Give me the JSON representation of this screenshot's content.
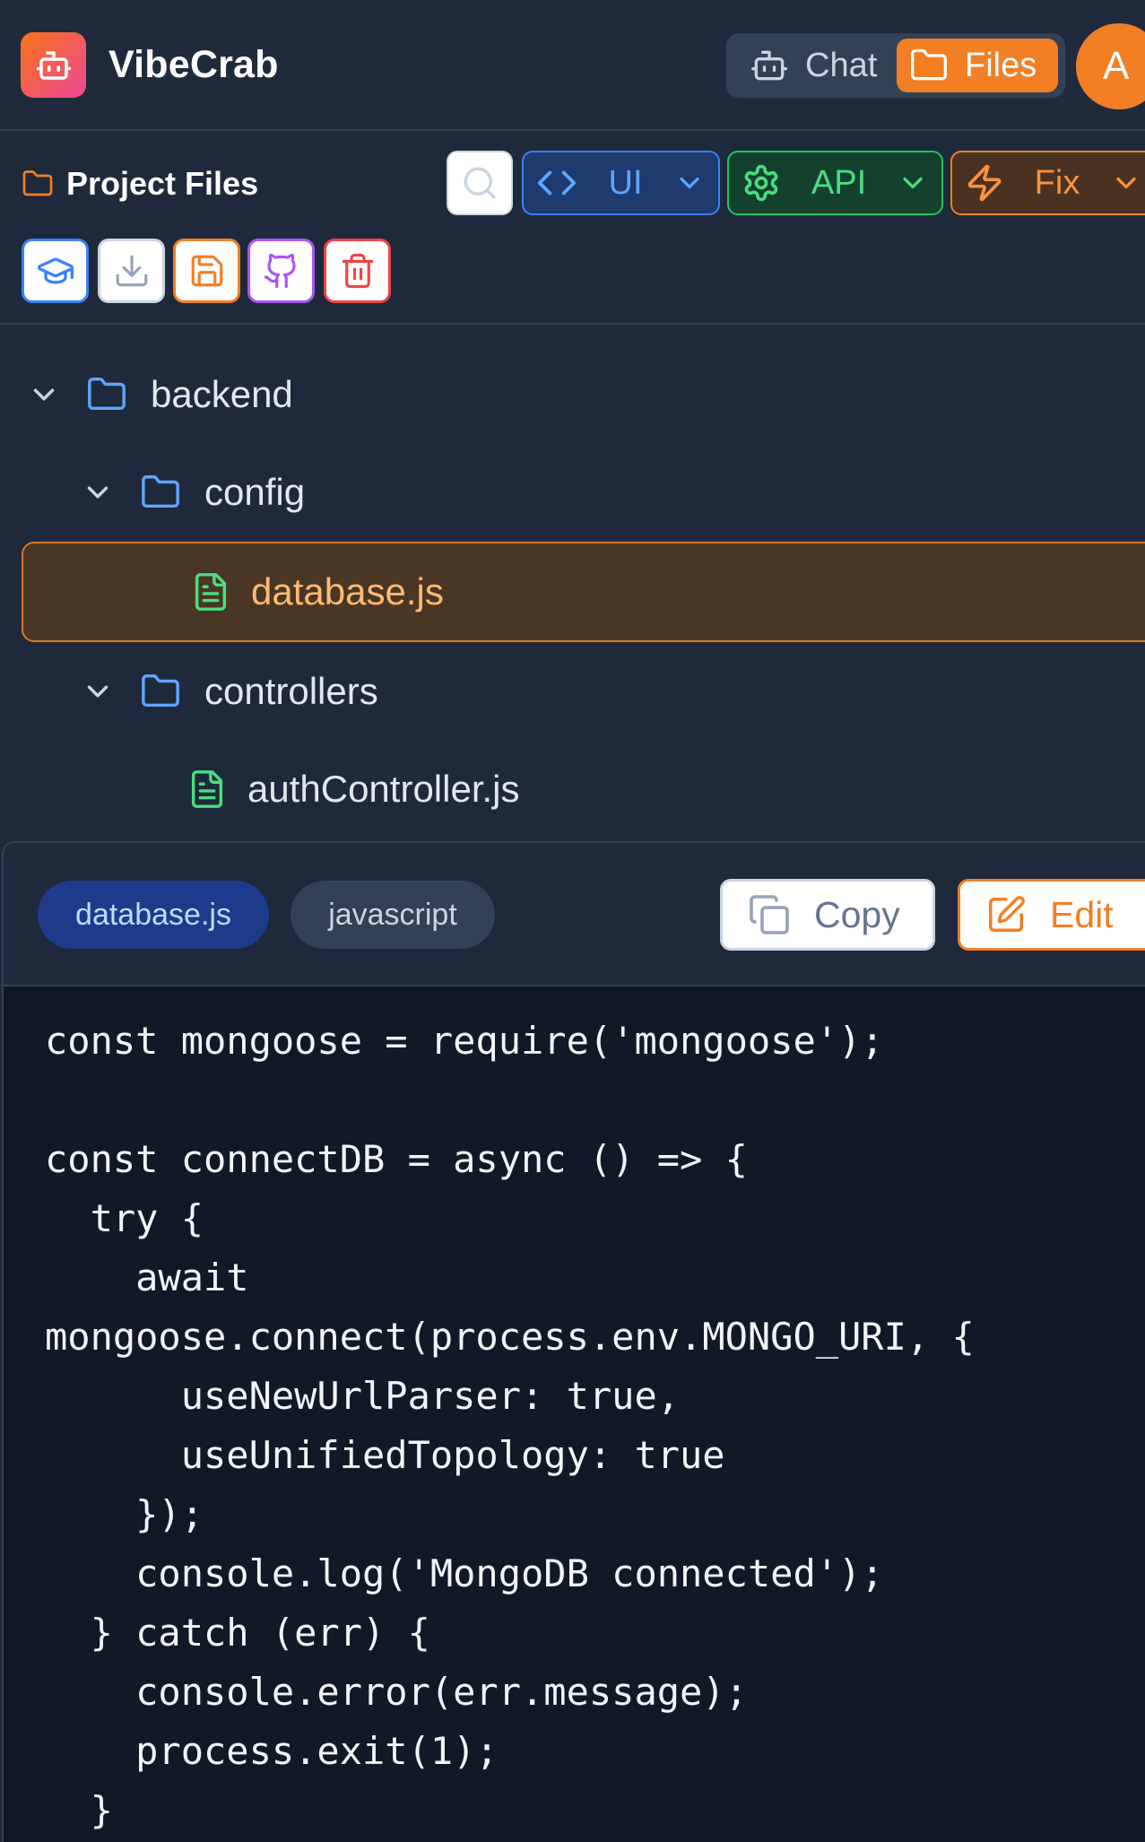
{
  "header": {
    "app_name": "VibeCrab",
    "logo_icon": "robot-icon",
    "view_toggle": {
      "chat_label": "Chat",
      "files_label": "Files",
      "active": "Files"
    },
    "avatar_initial": "A"
  },
  "files_panel": {
    "title": "Project Files",
    "generators": [
      {
        "label": "UI",
        "icon": "code-icon",
        "color": "#60a5fa"
      },
      {
        "label": "API",
        "icon": "gear-icon",
        "color": "#4ade80"
      },
      {
        "label": "Fix",
        "icon": "lightning-icon",
        "color": "#fb923c"
      }
    ],
    "toolbar_icons": [
      "graduation-cap-icon",
      "download-icon",
      "save-icon",
      "github-icon",
      "trash-icon"
    ],
    "tree": [
      {
        "name": "backend",
        "type": "folder",
        "expanded": true
      },
      {
        "name": "config",
        "type": "folder",
        "expanded": true
      },
      {
        "name": "database.js",
        "type": "file",
        "selected": true
      },
      {
        "name": "controllers",
        "type": "folder",
        "expanded": true
      },
      {
        "name": "authController.js",
        "type": "file",
        "selected": false
      }
    ]
  },
  "code_viewer": {
    "file_name": "database.js",
    "language": "javascript",
    "copy_label": "Copy",
    "edit_label": "Edit",
    "lines": [
      "const mongoose = require('mongoose');",
      "",
      "const connectDB = async () => {",
      "  try {",
      "    await",
      "mongoose.connect(process.env.MONGO_URI, {",
      "      useNewUrlParser: true,",
      "      useUnifiedTopology: true",
      "    });",
      "    console.log('MongoDB connected');",
      "  } catch (err) {",
      "    console.error(err.message);",
      "    process.exit(1);",
      "  }"
    ]
  },
  "colors": {
    "accent": "#f27f24",
    "background": "#1e293b",
    "code_background": "#111827"
  }
}
